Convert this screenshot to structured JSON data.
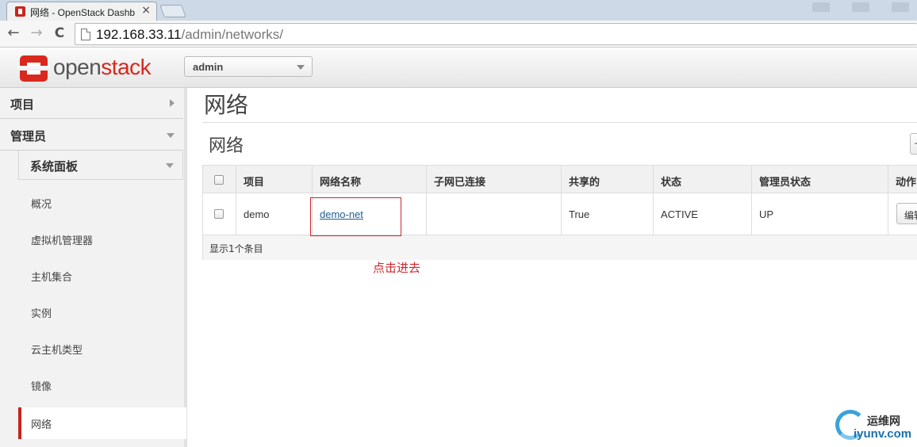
{
  "browser": {
    "tab_title": "网络 - OpenStack Dashb",
    "tab_close": "×",
    "back": "←",
    "forward": "→",
    "reload": "C",
    "url_host": "192.168.33.11",
    "url_path": "/admin/networks/"
  },
  "header": {
    "logo_open": "open",
    "logo_stack": "stack",
    "project_selector": "admin"
  },
  "sidebar": {
    "dashboards": [
      {
        "label": "项目",
        "expanded": false
      },
      {
        "label": "管理员",
        "expanded": true
      }
    ],
    "panel_group": "系统面板",
    "items": [
      {
        "label": "概况",
        "active": false
      },
      {
        "label": "虚拟机管理器",
        "active": false
      },
      {
        "label": "主机集合",
        "active": false
      },
      {
        "label": "实例",
        "active": false
      },
      {
        "label": "云主机类型",
        "active": false
      },
      {
        "label": "镜像",
        "active": false
      },
      {
        "label": "网络",
        "active": true
      }
    ]
  },
  "main": {
    "page_title": "网络",
    "section_title": "网络",
    "table": {
      "columns": [
        "项目",
        "网络名称",
        "子网已连接",
        "共享的",
        "状态",
        "管理员状态",
        "动作"
      ],
      "rows": [
        {
          "project": "demo",
          "network_name": "demo-net",
          "subnets": "",
          "shared": "True",
          "status": "ACTIVE",
          "admin_state": "UP",
          "action": "编辑"
        }
      ],
      "footer": "显示1个条目"
    },
    "annotation": "点击进去"
  },
  "watermark": {
    "cn": "运维网",
    "en": "iyunv.com"
  },
  "colors": {
    "brand_red": "#d9281d",
    "link": "#1f5e8c",
    "annotation_red": "#d0262b"
  }
}
